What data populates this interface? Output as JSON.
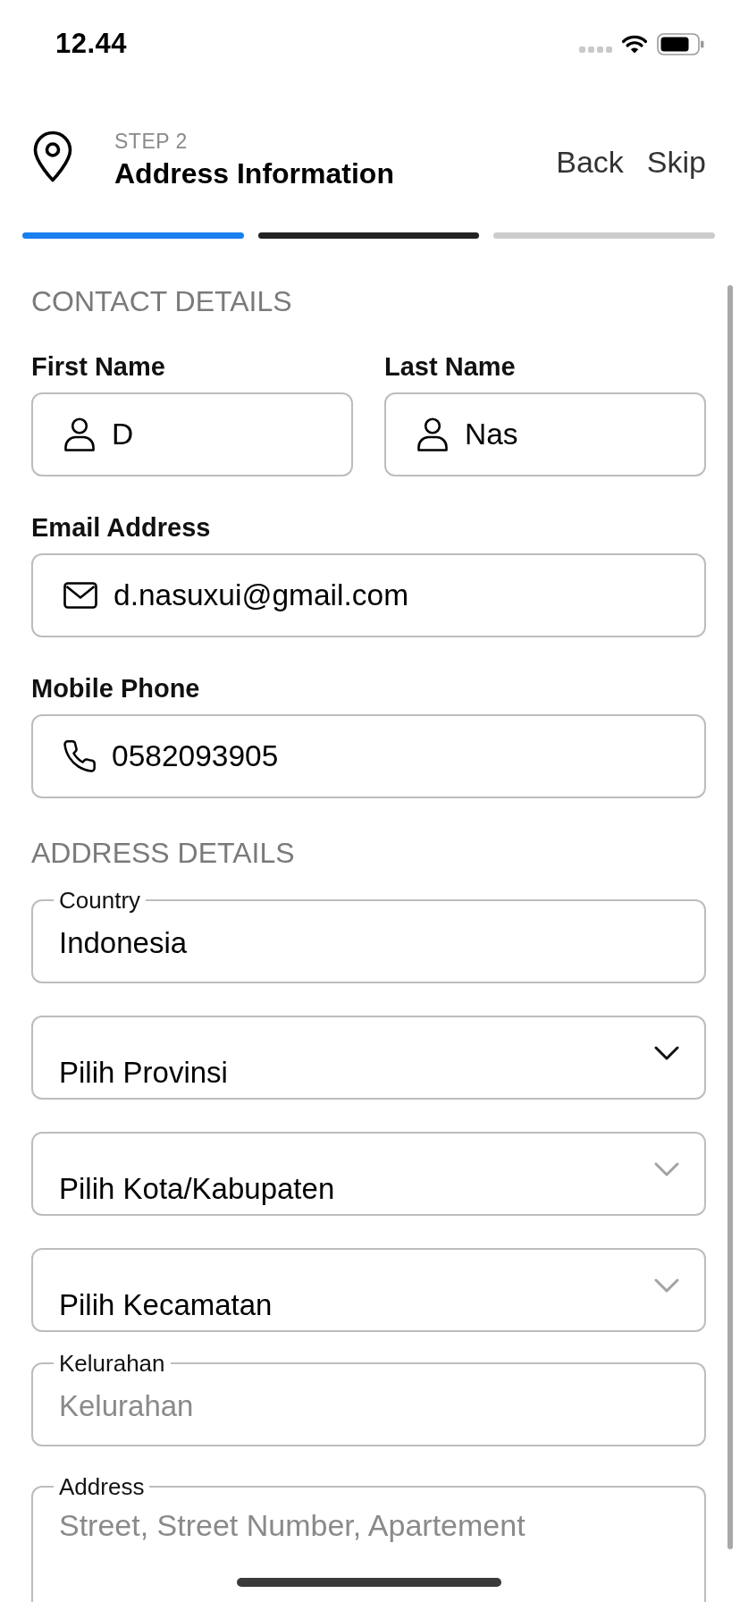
{
  "status_bar": {
    "time": "12.44"
  },
  "header": {
    "step": "STEP 2",
    "title": "Address Information",
    "back": "Back",
    "skip": "Skip"
  },
  "progress": [
    {
      "color": "#1a7ff0"
    },
    {
      "color": "#222222"
    },
    {
      "color": "#cccccc"
    }
  ],
  "contact_details": {
    "heading": "CONTACT DETAILS",
    "fields": [
      {
        "kind": "name",
        "label": "First Name",
        "value": "D"
      },
      {
        "kind": "name",
        "label": "Last Name",
        "value": "Nas"
      },
      {
        "kind": "email",
        "label": "Email Address",
        "value": "d.nasuxui@gmail.com"
      },
      {
        "kind": "phone",
        "label": "Mobile Phone",
        "value": "0582093905"
      }
    ]
  },
  "address_details": {
    "heading": "ADDRESS DETAILS",
    "fields": [
      {
        "kind": "text",
        "label": "Country",
        "value": "Indonesia"
      },
      {
        "kind": "select",
        "placeholder": "Pilih Provinsi",
        "disabled": false
      },
      {
        "kind": "select",
        "placeholder": "Pilih Kota/Kabupaten",
        "disabled": true
      },
      {
        "kind": "select",
        "placeholder": "Pilih Kecamatan",
        "disabled": true
      },
      {
        "kind": "text",
        "label": "Kelurahan",
        "placeholder": "Kelurahan"
      },
      {
        "kind": "textarea",
        "label": "Address",
        "placeholder": "Street, Street Number, Apartement"
      }
    ]
  }
}
